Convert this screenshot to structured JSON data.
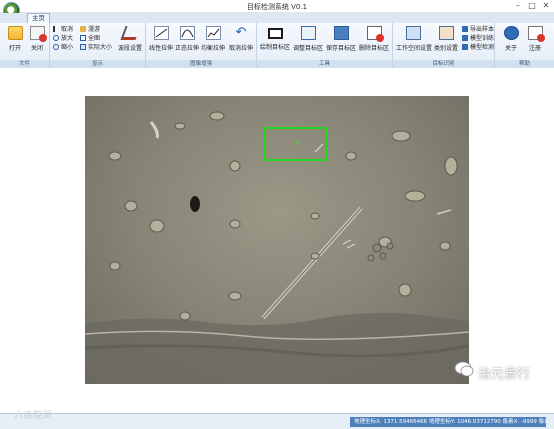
{
  "window": {
    "title": "目标检测系统 V0.1",
    "minimize": "–",
    "maximize": "□",
    "close": "✕"
  },
  "tabs": {
    "home": "主页"
  },
  "ribbon": {
    "file": {
      "label": "文件",
      "open": "打开",
      "close": "关闭"
    },
    "display": {
      "label": "显示",
      "cancel": "取消",
      "zoom_in": "放大",
      "zoom_out": "缩小",
      "roam": "漫游",
      "full_image": "全图",
      "actual_size": "实际大小",
      "band_settings": "波段设置"
    },
    "enhance": {
      "label": "图像增强",
      "linear_stretch": "线性拉伸",
      "normal_stretch": "正态拉伸",
      "equalize_stretch": "均衡拉伸",
      "cancel_stretch": "取消拉伸"
    },
    "tools": {
      "label": "工具",
      "draw_target": "绘制目标区",
      "adjust_target": "调整目标区",
      "save_target": "保存目标区",
      "delete_target": "删除目标区"
    },
    "recognition": {
      "label": "目标识别",
      "workspace_settings": "工作空间设置",
      "category_settings": "类别设置",
      "export_samples": "导出样本",
      "model_training": "模型训练",
      "model_detection": "模型检测"
    },
    "help": {
      "label": "帮助",
      "about": "关于",
      "logout": "注册"
    }
  },
  "detection": {
    "label": "0"
  },
  "status": {
    "text": "地理坐标X: 1371.59466466 地理坐标Y: 1046.03712790 像素X: -9999 像素Y: -9999"
  },
  "watermarks": {
    "left": "六级院润",
    "right": "治元景行"
  },
  "colors": {
    "ribbon_bg": "#e3ecf7",
    "status_bg": "#4d7fba",
    "detection_box": "#29d41f"
  },
  "icons": [
    "app-logo-icon",
    "folder-icon",
    "close-doc-icon",
    "wave-icon",
    "rect-icon",
    "save-icon",
    "delete-icon",
    "info-icon"
  ]
}
